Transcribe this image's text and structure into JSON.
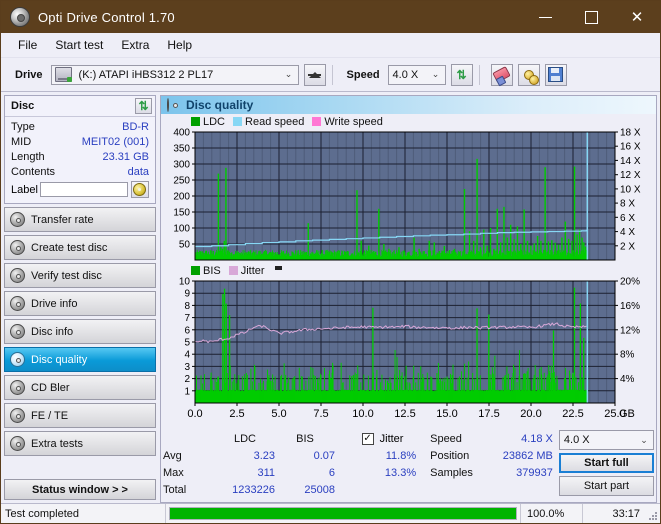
{
  "window": {
    "title": "Opti Drive Control 1.70",
    "icon": "disc-icon",
    "minimize": "–",
    "maximize": "□",
    "close": "✕",
    "titlebar_color": "#5c3f1d"
  },
  "menu": {
    "items": [
      "File",
      "Start test",
      "Extra",
      "Help"
    ]
  },
  "toolbar": {
    "drive_label": "Drive",
    "drive_value": "(K:)  ATAPI iHBS312  2 PL17",
    "eject_icon": "eject-icon",
    "speed_label": "Speed",
    "speed_value": "4.0 X",
    "refresh_icon": "refresh-icon",
    "erase_icon": "eraser-icon",
    "bitsetting_icon": "gold-discs-icon",
    "save_icon": "floppy-save-icon",
    "chevron": "⌄"
  },
  "sidebar": {
    "disc_panel": {
      "title": "Disc",
      "refresh_icon": "refresh-icon",
      "rows": [
        {
          "key": "Type",
          "value": "BD-R"
        },
        {
          "key": "MID",
          "value": "MEIT02 (001)"
        },
        {
          "key": "Length",
          "value": "23.31 GB"
        },
        {
          "key": "Contents",
          "value": "data"
        }
      ],
      "label_key": "Label",
      "label_value": "",
      "label_placeholder": "",
      "label_button_icon": "disc-label-icon"
    },
    "nav": [
      {
        "label": "Transfer rate",
        "icon": "disc-icon",
        "selected": false
      },
      {
        "label": "Create test disc",
        "icon": "disc-icon",
        "selected": false
      },
      {
        "label": "Verify test disc",
        "icon": "disc-icon",
        "selected": false
      },
      {
        "label": "Drive info",
        "icon": "disc-icon",
        "selected": false
      },
      {
        "label": "Disc info",
        "icon": "disc-icon",
        "selected": false
      },
      {
        "label": "Disc quality",
        "icon": "disc-icon",
        "selected": true
      },
      {
        "label": "CD Bler",
        "icon": "disc-icon",
        "selected": false
      },
      {
        "label": "FE / TE",
        "icon": "disc-icon",
        "selected": false
      },
      {
        "label": "Extra tests",
        "icon": "disc-icon",
        "selected": false
      }
    ],
    "status_window_button": "Status window > >"
  },
  "panel": {
    "title": "Disc quality",
    "icon": "disc-icon"
  },
  "chart_data": [
    {
      "type": "line",
      "name": "top-chart",
      "title": "",
      "legend": [
        {
          "label": "LDC",
          "color": "#00a000"
        },
        {
          "label": "Read speed",
          "color": "#87d7f5"
        },
        {
          "label": "Write speed",
          "color": "#ff77d4"
        }
      ],
      "legend_position": "top-left",
      "grid": true,
      "xlabel": "GB",
      "x_ticks": [
        "0.0",
        "2.5",
        "5.0",
        "7.5",
        "10.0",
        "12.5",
        "15.0",
        "17.5",
        "20.0",
        "22.5",
        "25.0"
      ],
      "xlim": [
        0,
        25
      ],
      "ylabel_left": "LDC",
      "y_ticks_left": [
        "50",
        "100",
        "150",
        "200",
        "250",
        "300",
        "350",
        "400"
      ],
      "ylim_left": [
        0,
        400
      ],
      "ylabel_right": "Speed",
      "y_ticks_right": [
        "2 X",
        "4 X",
        "6 X",
        "8 X",
        "10 X",
        "12 X",
        "14 X",
        "16 X",
        "18 X"
      ],
      "ylim_right": [
        0,
        18
      ],
      "plot_bg": "#5d6d8f",
      "series": [
        {
          "name": "LDC",
          "type": "bar",
          "color": "#00cc00",
          "x": [
            0.1,
            0.3,
            0.5,
            0.7,
            0.9,
            1.05,
            1.2,
            1.35,
            1.5,
            1.6,
            1.7,
            1.8,
            1.9,
            2.0,
            2.1,
            2.25,
            2.4,
            2.6,
            2.8,
            3.0,
            3.2,
            3.4,
            3.6,
            3.8,
            4.0,
            4.3,
            4.6,
            4.9,
            5.2,
            5.5,
            5.8,
            6.1,
            6.4,
            6.7,
            6.95,
            7.2,
            7.5,
            7.8,
            8.1,
            8.4,
            8.7,
            9.0,
            9.3,
            9.6,
            9.85,
            10.05,
            10.3,
            10.6,
            10.9,
            11.2,
            11.5,
            11.8,
            12.1,
            12.4,
            12.7,
            13.0,
            13.3,
            13.6,
            13.9,
            14.2,
            14.5,
            14.8,
            15.1,
            15.4,
            15.7,
            16.0,
            16.3,
            16.55,
            16.75,
            16.95,
            17.15,
            17.35,
            17.55,
            17.75,
            17.95,
            18.15,
            18.35,
            18.55,
            18.75,
            18.95,
            19.15,
            19.35,
            19.55,
            19.75,
            19.95,
            20.15,
            20.35,
            20.55,
            20.8,
            21.0,
            21.2,
            21.4,
            21.6,
            21.8,
            22.0,
            22.2,
            22.4,
            22.55,
            22.7,
            22.85,
            23.0,
            23.1,
            23.2,
            23.3
          ],
          "values": [
            25,
            20,
            22,
            18,
            30,
            28,
            24,
            270,
            40,
            35,
            60,
            288,
            30,
            25,
            22,
            18,
            20,
            16,
            18,
            15,
            20,
            14,
            18,
            16,
            20,
            18,
            22,
            16,
            20,
            18,
            22,
            20,
            18,
            115,
            24,
            20,
            22,
            18,
            24,
            20,
            22,
            18,
            20,
            218,
            60,
            30,
            45,
            28,
            160,
            50,
            35,
            28,
            40,
            30,
            26,
            70,
            35,
            28,
            60,
            55,
            28,
            44,
            30,
            35,
            26,
            222,
            90,
            60,
            316,
            40,
            95,
            45,
            100,
            35,
            160,
            55,
            166,
            70,
            110,
            65,
            105,
            50,
            158,
            60,
            45,
            52,
            75,
            60,
            290,
            58,
            62,
            54,
            48,
            70,
            120,
            66,
            60,
            292,
            80,
            95,
            70,
            55,
            42,
            30
          ]
        },
        {
          "name": "Read speed",
          "type": "line",
          "color": "#87d7f5",
          "x": [
            0.0,
            1.0,
            2.0,
            3.0,
            4.0,
            5.0,
            6.0,
            7.0,
            8.0,
            9.0,
            10.0,
            11.0,
            12.0,
            13.0,
            14.0,
            15.0,
            16.0,
            17.0,
            18.0,
            19.0,
            20.0,
            21.0,
            22.0,
            23.0,
            23.3,
            23.35
          ],
          "values": [
            1.9,
            2.0,
            2.15,
            2.3,
            2.45,
            2.55,
            2.7,
            2.8,
            2.9,
            3.0,
            3.1,
            3.2,
            3.3,
            3.4,
            3.5,
            3.55,
            3.65,
            3.75,
            3.85,
            3.9,
            3.95,
            4.0,
            4.05,
            4.1,
            4.15,
            18.0
          ]
        }
      ]
    },
    {
      "type": "line",
      "name": "bottom-chart",
      "title": "",
      "legend": [
        {
          "label": "BIS",
          "color": "#00a000"
        },
        {
          "label": "Jitter",
          "color": "#d8a8d8"
        }
      ],
      "legend_position": "top-left",
      "grid": true,
      "xlabel": "GB",
      "x_ticks": [
        "0.0",
        "2.5",
        "5.0",
        "7.5",
        "10.0",
        "12.5",
        "15.0",
        "17.5",
        "20.0",
        "22.5",
        "25.0"
      ],
      "xlim": [
        0,
        25
      ],
      "ylabel_left": "BIS",
      "y_ticks_left": [
        "1",
        "2",
        "3",
        "4",
        "5",
        "6",
        "7",
        "8",
        "9",
        "10"
      ],
      "ylim_left": [
        0,
        10
      ],
      "ylabel_right": "Jitter",
      "y_ticks_right": [
        "4%",
        "8%",
        "12%",
        "16%",
        "20%"
      ],
      "ylim_right": [
        0,
        20
      ],
      "plot_bg": "#5d6d8f",
      "series": [
        {
          "name": "BIS",
          "type": "bar",
          "color": "#00cc00",
          "baseline": 1.0
        },
        {
          "name": "Jitter",
          "type": "line",
          "color": "#d8a8d8",
          "x": [
            0.0,
            0.5,
            1.0,
            1.5,
            2.0,
            2.5,
            3.0,
            3.5,
            4.0,
            4.5,
            5.0,
            5.5,
            6.0,
            6.5,
            7.0,
            7.5,
            8.0,
            8.5,
            9.0,
            9.5,
            10.0,
            10.5,
            11.0,
            11.5,
            12.0,
            12.5,
            13.0,
            13.5,
            14.0,
            14.5,
            15.0,
            15.5,
            16.0,
            16.5,
            17.0,
            17.5,
            18.0,
            18.5,
            19.0,
            19.5,
            20.0,
            20.5,
            21.0,
            21.5,
            22.0,
            22.5,
            23.0,
            23.3
          ],
          "values": [
            5.0,
            5.1,
            5.0,
            5.2,
            5.3,
            5.6,
            5.8,
            6.2,
            6.3,
            6.0,
            5.7,
            5.8,
            5.9,
            6.0,
            6.05,
            6.1,
            6.1,
            6.15,
            6.2,
            6.2,
            6.25,
            6.2,
            6.2,
            6.25,
            6.2,
            6.3,
            6.2,
            6.2,
            6.2,
            6.15,
            6.2,
            6.1,
            6.2,
            6.2,
            6.15,
            6.2,
            6.2,
            6.2,
            6.25,
            6.2,
            6.2,
            6.3,
            6.4,
            6.5,
            6.3,
            6.2,
            6.25,
            6.2
          ]
        }
      ]
    }
  ],
  "stats": {
    "col_headers": [
      "LDC",
      "BIS"
    ],
    "row_labels": [
      "Avg",
      "Max",
      "Total"
    ],
    "ldc": {
      "avg": "3.23",
      "max": "311",
      "total": "1233226"
    },
    "bis": {
      "avg": "0.07",
      "max": "6",
      "total": "25008"
    },
    "jitter": {
      "label": "Jitter",
      "checked": true,
      "check_glyph": "✓",
      "avg": "11.8%",
      "max": "13.3%"
    },
    "speed_label": "Speed",
    "speed_value": "4.18 X",
    "position_label": "Position",
    "position_value": "23862 MB",
    "samples_label": "Samples",
    "samples_value": "379937",
    "speed_select": "4.0 X",
    "speed_chevron": "⌄",
    "start_full": "Start full",
    "start_part": "Start part"
  },
  "statusbar": {
    "text": "Test completed",
    "progress_percent": 100,
    "percent_label": "100.0%",
    "time": "33:17"
  }
}
